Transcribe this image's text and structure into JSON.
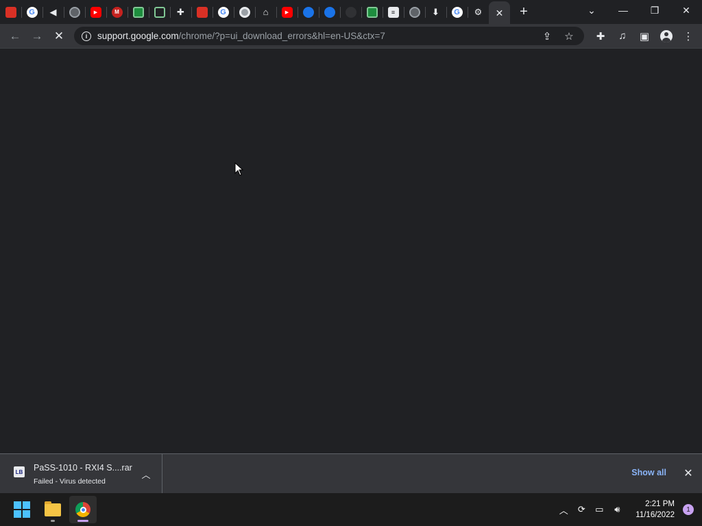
{
  "tabs": [
    {
      "icon": "shopping-bag-icon",
      "label": ""
    },
    {
      "icon": "google-icon",
      "label": "G"
    },
    {
      "icon": "audio-icon",
      "label": ""
    },
    {
      "icon": "globe-icon",
      "label": ""
    },
    {
      "icon": "youtube-icon",
      "label": "▶"
    },
    {
      "icon": "gmail-icon",
      "label": "M"
    },
    {
      "icon": "sheet-icon",
      "label": ""
    },
    {
      "icon": "green-square-icon",
      "label": ""
    },
    {
      "icon": "extension-puzzle-icon",
      "label": ""
    },
    {
      "icon": "shopping-bag-icon",
      "label": ""
    },
    {
      "icon": "google-icon",
      "label": "G"
    },
    {
      "icon": "chrome-icon",
      "label": ""
    },
    {
      "icon": "bank-icon",
      "label": ""
    },
    {
      "icon": "youtube-icon",
      "label": "▶"
    },
    {
      "icon": "blue-circle-icon",
      "label": ""
    },
    {
      "icon": "blue-circle-icon",
      "label": ""
    },
    {
      "icon": "github-icon",
      "label": ""
    },
    {
      "icon": "sheet-icon",
      "label": ""
    },
    {
      "icon": "document-icon",
      "label": ""
    },
    {
      "icon": "globe-icon",
      "label": ""
    },
    {
      "icon": "download-icon",
      "label": ""
    },
    {
      "icon": "google-icon",
      "label": "G"
    },
    {
      "icon": "settings-gear-icon",
      "label": ""
    }
  ],
  "active_tab": {
    "close_label": "✕"
  },
  "new_tab_label": "+",
  "window": {
    "tab_search": "⌄",
    "minimize": "—",
    "restore": "❐",
    "close": "✕"
  },
  "toolbar": {
    "back": "←",
    "forward": "→",
    "stop": "✕",
    "url_host": "support.google.com",
    "url_path": "/chrome/?p=ui_download_errors&hl=en-US&ctx=7",
    "info_glyph": "i"
  },
  "download": {
    "file_name": "PaSS-1010 - RXI4 S....rar",
    "status": "Failed - Virus detected",
    "icon_label": "LB",
    "show_all": "Show all"
  },
  "taskbar": {
    "time": "2:21 PM",
    "date": "11/16/2022",
    "notifications": "1"
  }
}
